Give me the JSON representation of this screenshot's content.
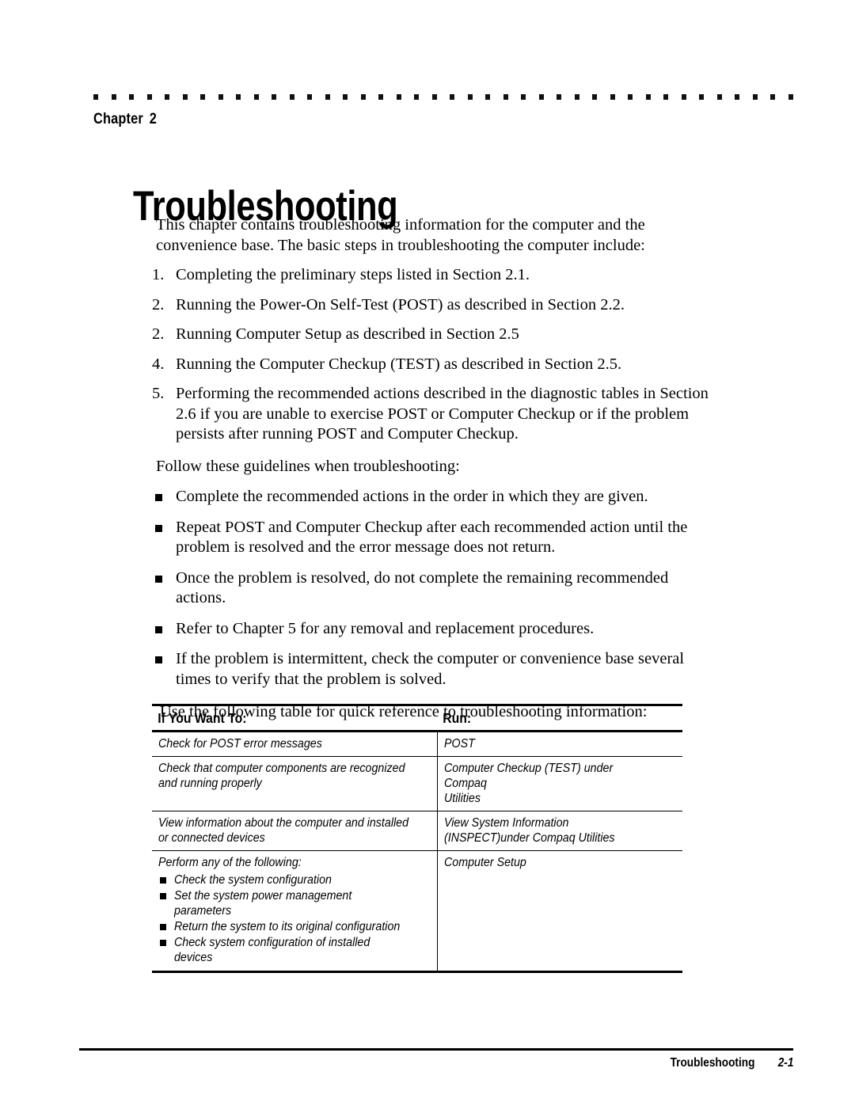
{
  "header": {
    "chapter_word": "Chapter",
    "chapter_number": "2",
    "title": "Troubleshooting"
  },
  "intro": {
    "paragraph": "This chapter contains troubleshooting information for the computer and the convenience base. The basic steps in troubleshooting the computer include:"
  },
  "steps": [
    {
      "marker": "1.",
      "text": "Completing the preliminary steps listed in Section 2.1."
    },
    {
      "marker": "2.",
      "text": "Running the Power-On Self-Test (POST) as described in Section 2.2."
    },
    {
      "marker": "2.",
      "text": "Running Computer Setup as described in Section 2.5"
    },
    {
      "marker": "4.",
      "text": "Running the Computer Checkup (TEST) as described in Section 2.5."
    },
    {
      "marker": "5.",
      "text": "Performing the recommended actions described in the diagnostic tables in Section 2.6 if you are unable to exercise POST or Computer Checkup or if the problem persists after running POST and Computer Checkup."
    }
  ],
  "guidelines_intro": "Follow these guidelines when troubleshooting:",
  "guidelines": [
    "Complete the recommended actions in the order in which they are given.",
    "Repeat POST and Computer Checkup after each recommended action until the problem is resolved and the error message does not return.",
    "Once the problem is resolved, do not complete the remaining recommended actions.",
    "Refer to Chapter 5 for any removal and replacement procedures.",
    "If the problem is intermittent, check the computer or convenience base several times to verify that the problem is solved."
  ],
  "table_intro": "Use the following table for quick reference to troubleshooting information:",
  "table": {
    "headers": [
      "If You Want To:",
      "Run:"
    ],
    "rows": [
      {
        "want_to": "Check for POST error messages",
        "run_line1": "POST",
        "run_line2": ""
      },
      {
        "want_to": "Check that computer components are recognized and running properly",
        "run_line1": "Computer Checkup (TEST) under",
        "run_line1_tail": "Compaq",
        "run_line2": "Utilities"
      },
      {
        "want_to": "View information about the computer and installed or connected devices",
        "run_line1": "View System Information",
        "run_line2": "(INSPECT)under Compaq Utilities"
      },
      {
        "want_to": "Perform any of the following:",
        "sub_items": [
          "Check the system configuration",
          "Set the system power management parameters",
          "Return the system to its original configuration",
          "Check system configuration of installed devices"
        ],
        "run_line1": "Computer Setup",
        "run_line2": ""
      }
    ]
  },
  "footer": {
    "section_name": "Troubleshooting",
    "page_number": "2-1"
  }
}
